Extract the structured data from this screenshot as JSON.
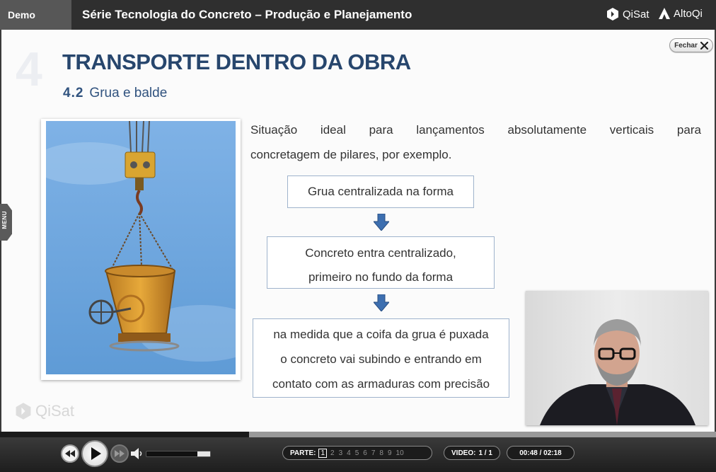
{
  "header": {
    "demo_label": "Demo",
    "course_title": "Série Tecnologia do Concreto – Produção e Planejamento",
    "brand_qisat": "QiSat",
    "brand_altoqi": "AltoQi"
  },
  "slide": {
    "section_number": "4",
    "section_title": "TRANSPORTE DENTRO DA OBRA",
    "subsection_number": "4.2",
    "subsection_title": "Grua e balde",
    "close_label": "Fechar",
    "menu_label": "MENU",
    "intro_line1_words": [
      "Situação",
      "ideal",
      "para",
      "lançamentos",
      "absolutamente",
      "verticais",
      "para"
    ],
    "intro_line2": "concretagem de pilares, por exemplo.",
    "flow": {
      "step1": "Grua centralizada na forma",
      "step2_line1": "Concreto entra centralizado,",
      "step2_line2": "primeiro no fundo da forma",
      "step3_line1": "na medida que a coifa da grua é puxada",
      "step3_line2": "o concreto vai subindo e entrando em",
      "step3_line3": "contato com as armaduras com precisão"
    },
    "watermark": "QiSat"
  },
  "player": {
    "progress_fraction": 0.348,
    "volume_fraction": 0.2,
    "parts_label": "PARTE:",
    "parts": [
      "1",
      "2",
      "3",
      "4",
      "5",
      "6",
      "7",
      "8",
      "9",
      "10"
    ],
    "active_part": "1",
    "video_label": "VIDEO:",
    "video_value": "1 / 1",
    "time": "00:48 / 02:18"
  },
  "colors": {
    "title_blue": "#27466d",
    "flow_border": "#9fb3cc",
    "arrow_blue": "#3d6fb0",
    "topbar": "#2f2f2f"
  }
}
